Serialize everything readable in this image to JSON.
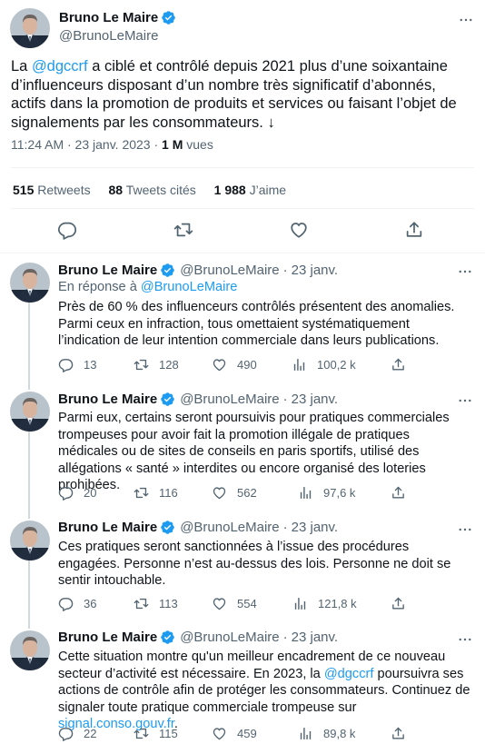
{
  "main": {
    "name": "Bruno Le Maire",
    "handle": "@BrunoLeMaire",
    "text_pre": "La ",
    "mention": "@dgccrf",
    "text_post": " a ciblé et contrôlé depuis 2021 plus d’une soixantaine d’influenceurs disposant d’un nombre très significatif d’abonnés, actifs dans la promotion de produits et services ou faisant l’objet de signalements par les consommateurs. ↓",
    "time": "11:24 AM · 23 janv. 2023 · ",
    "views": "1 M",
    "views_label": " vues",
    "retweets": "515",
    "retweets_label": "Retweets",
    "quotes": "88",
    "quotes_label": "Tweets cités",
    "likes": "1 988",
    "likes_label": "J’aime"
  },
  "replies": [
    {
      "name": "Bruno Le Maire",
      "handle": "@BrunoLeMaire",
      "date": "23 janv.",
      "reply_to_label": "En réponse à ",
      "reply_to_handle": "@BrunoLeMaire",
      "text": "Près de 60 % des influenceurs contrôlés présentent des anomalies. Parmi ceux en infraction, tous omettaient systématiquement l’indication de leur intention commerciale dans leurs publications.",
      "replies": "13",
      "retweets": "128",
      "likes": "490",
      "views": "100,2 k"
    },
    {
      "name": "Bruno Le Maire",
      "handle": "@BrunoLeMaire",
      "date": "23 janv.",
      "text": "Parmi eux, certains seront poursuivis pour pratiques commerciales trompeuses pour avoir fait la promotion illégale de pratiques médicales ou de sites de conseils en paris sportifs, utilisé des allégations « santé » interdites ou encore organisé des loteries prohibées.",
      "replies": "20",
      "retweets": "116",
      "likes": "562",
      "views": "97,6 k"
    },
    {
      "name": "Bruno Le Maire",
      "handle": "@BrunoLeMaire",
      "date": "23 janv.",
      "text": "Ces pratiques seront sanctionnées à l’issue des procédures engagées. Personne n’est au-dessus des lois. Personne ne doit se sentir intouchable.",
      "replies": "36",
      "retweets": "113",
      "likes": "554",
      "views": "121,8 k"
    },
    {
      "name": "Bruno Le Maire",
      "handle": "@BrunoLeMaire",
      "date": "23 janv.",
      "text_a": "Cette situation montre qu'un meilleur encadrement de ce nouveau secteur d’activité est nécessaire. En 2023, la ",
      "mention": "@dgccrf",
      "text_b": " poursuivra ses actions de contrôle afin de protéger les consommateurs. Continuez de signaler toute pratique commerciale trompeuse sur ",
      "link": "signal.conso.gouv.fr",
      "text_c": ".",
      "replies": "22",
      "retweets": "115",
      "likes": "459",
      "views": "89,8 k"
    }
  ],
  "icons": {
    "verified": "verified-badge-icon",
    "more": "more-horizontal-icon",
    "reply": "reply-bubble-icon",
    "retweet": "retweet-icon",
    "like": "heart-icon",
    "views": "views-bar-icon",
    "share": "share-icon"
  },
  "colors": {
    "text": "#0f1419",
    "secondary": "#536471",
    "link": "#1d9bf0",
    "verified": "#1d9bf0",
    "divider": "#eff3f4",
    "thread": "#cfd9de"
  }
}
